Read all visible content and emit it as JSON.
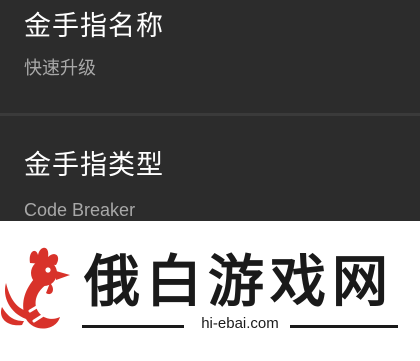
{
  "settings": [
    {
      "title": "金手指名称",
      "value": "快速升级"
    },
    {
      "title": "金手指类型",
      "value": "Code Breaker"
    }
  ],
  "watermark": {
    "brand": "俄白游戏网",
    "url": "hi-ebai.com"
  },
  "colors": {
    "panel_bg": "#2c2c2c",
    "title_text": "#ffffff",
    "value_text": "#a8a8a8",
    "rooster_red": "#d8322a"
  }
}
